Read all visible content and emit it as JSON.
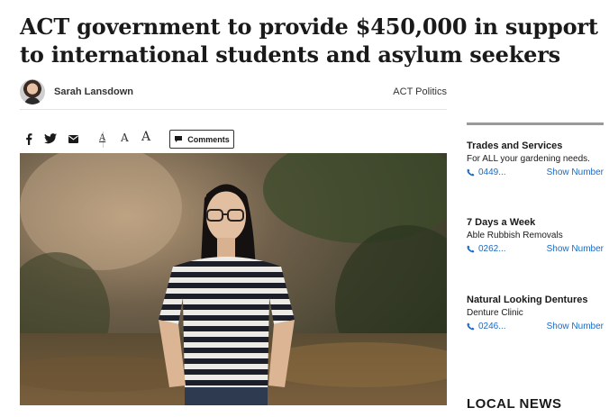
{
  "article": {
    "headline": "ACT government to provide $450,000 in support to international students and asylum seekers",
    "author": "Sarah Lansdown",
    "category": "ACT Politics"
  },
  "share_bar": {
    "icons": [
      "facebook-icon",
      "twitter-icon",
      "email-icon"
    ],
    "font_sizes": [
      "A",
      "A",
      "A"
    ],
    "comments_label": "Comments"
  },
  "sidebar": {
    "ads": [
      {
        "title": "Trades and Services",
        "subtitle": "For ALL your gardening needs.",
        "phone": "0449...",
        "show_label": "Show Number"
      },
      {
        "title": "7 Days a Week",
        "subtitle": "Able Rubbish Removals",
        "phone": "0262...",
        "show_label": "Show Number"
      },
      {
        "title": "Natural Looking Dentures",
        "subtitle": "Denture Clinic",
        "phone": "0246...",
        "show_label": "Show Number"
      }
    ],
    "section_heading": "LOCAL NEWS"
  },
  "colors": {
    "link": "#1b6ac2",
    "text": "#1a1a1a",
    "rule": "#9a9a9a"
  }
}
